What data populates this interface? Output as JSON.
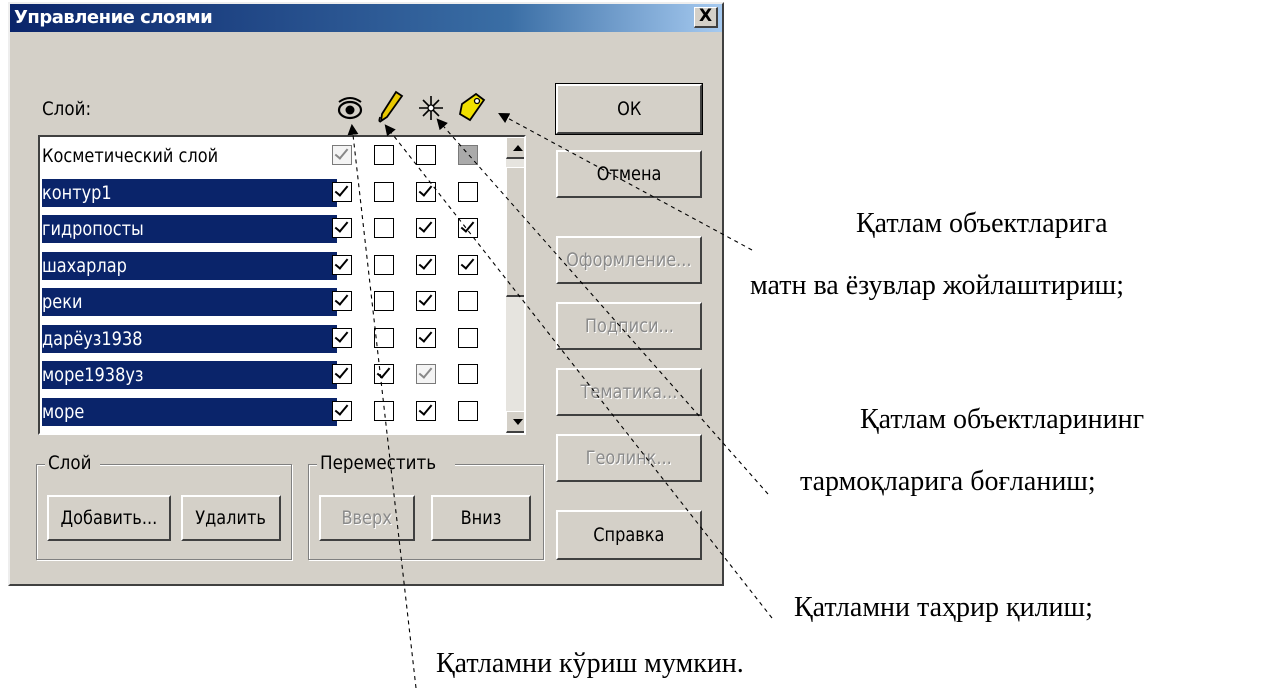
{
  "dialog": {
    "title": "Управление слоями",
    "close_label": "X",
    "layer_label": "Слой:",
    "columns": [
      {
        "icon": "eye-icon",
        "meaning": "visible"
      },
      {
        "icon": "pencil-icon",
        "meaning": "editable"
      },
      {
        "icon": "snap-star-icon",
        "meaning": "snap"
      },
      {
        "icon": "tag-label-icon",
        "meaning": "labels"
      }
    ],
    "layers": [
      {
        "name": "Косметический слой",
        "selected": false,
        "checks": [
          "gray-tick",
          "empty",
          "empty",
          "gray-fill"
        ]
      },
      {
        "name": "контур1",
        "selected": true,
        "checks": [
          "tick",
          "empty",
          "tick",
          "empty"
        ]
      },
      {
        "name": "гидропосты",
        "selected": true,
        "checks": [
          "tick",
          "empty",
          "tick",
          "tick"
        ]
      },
      {
        "name": "шахарлар",
        "selected": true,
        "checks": [
          "tick",
          "empty",
          "tick",
          "tick"
        ]
      },
      {
        "name": "реки",
        "selected": true,
        "checks": [
          "tick",
          "empty",
          "tick",
          "empty"
        ]
      },
      {
        "name": "дарёуз1938",
        "selected": true,
        "checks": [
          "tick",
          "empty",
          "tick",
          "empty"
        ]
      },
      {
        "name": "море1938уз",
        "selected": true,
        "checks": [
          "tick",
          "tick",
          "gray-tick",
          "empty"
        ]
      },
      {
        "name": "море",
        "selected": true,
        "checks": [
          "tick",
          "empty",
          "tick",
          "empty"
        ]
      }
    ],
    "group_layer": {
      "title": "Слой",
      "add": "Добавить...",
      "delete": "Удалить"
    },
    "group_move": {
      "title": "Переместить",
      "up": "Вверх",
      "down": "Вниз"
    },
    "buttons": {
      "ok": "ОК",
      "cancel": "Отмена",
      "style": "Оформление...",
      "labels": "Подписи...",
      "thematic": "Тематика...",
      "geolink": "Геолинк...",
      "help": "Справка"
    }
  },
  "annotations": {
    "labels_line1": "Қатлам объектларига",
    "labels_line2": "матн ва ёзувлар жойлаштириш;",
    "snap_line1": "Қатлам объектларининг",
    "snap_line2": "тармоқларига боғланиш;",
    "edit": "Қатламни таҳрир қилиш;",
    "visible": "Қатламни кўриш мумкин."
  },
  "colors": {
    "selection": "#0a246a",
    "face": "#d4d0c8",
    "icon_pencil": "#e8c800",
    "icon_tag": "#f0e000"
  }
}
